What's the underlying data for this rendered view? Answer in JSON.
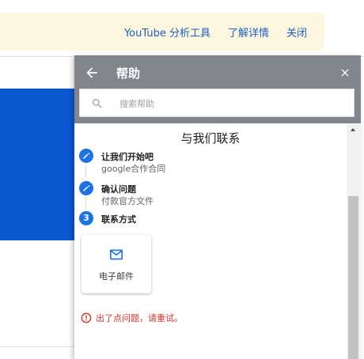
{
  "notice": {
    "links": [
      "YouTube 分析工具",
      "了解详情",
      "关闭"
    ]
  },
  "help": {
    "title": "帮助",
    "search_placeholder": "搜索帮助",
    "heading": "与我们联系",
    "steps": [
      {
        "title": "让我们开始吧",
        "subtitle": "google合作合同",
        "icon": "pencil-icon"
      },
      {
        "title": "确认问题",
        "subtitle": "付款官方文件",
        "icon": "pencil-icon"
      },
      {
        "title": "联系方式",
        "number": "3"
      }
    ],
    "contact_option": {
      "label": "电子邮件",
      "icon": "mail-icon"
    },
    "error_text": "出了点问题，请重试。"
  },
  "colors": {
    "accent": "#1a73e8",
    "header_gray": "#80868b",
    "error": "#d93025",
    "notice_bg": "#fdf6df",
    "brand_blue": "#0b57cf"
  }
}
